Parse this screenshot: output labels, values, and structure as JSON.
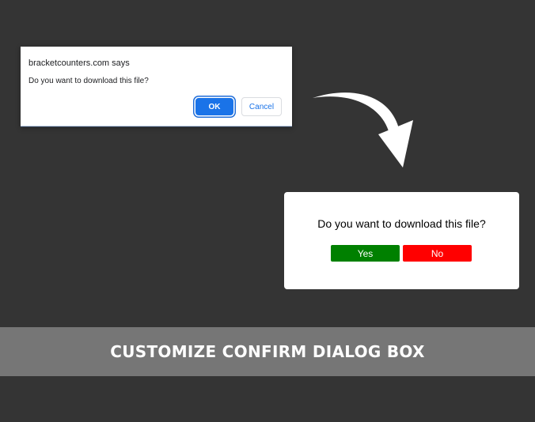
{
  "native_dialog": {
    "title": "bracketcounters.com says",
    "message": "Do you want to download this file?",
    "ok_label": "OK",
    "cancel_label": "Cancel"
  },
  "arrow": {
    "icon": "curved-arrow-icon",
    "color": "#ffffff"
  },
  "custom_dialog": {
    "message": "Do you want to download this file?",
    "yes_label": "Yes",
    "no_label": "No",
    "yes_color": "#008000",
    "no_color": "#ff0000"
  },
  "banner": {
    "text": "CUSTOMIZE CONFIRM DIALOG BOX"
  }
}
